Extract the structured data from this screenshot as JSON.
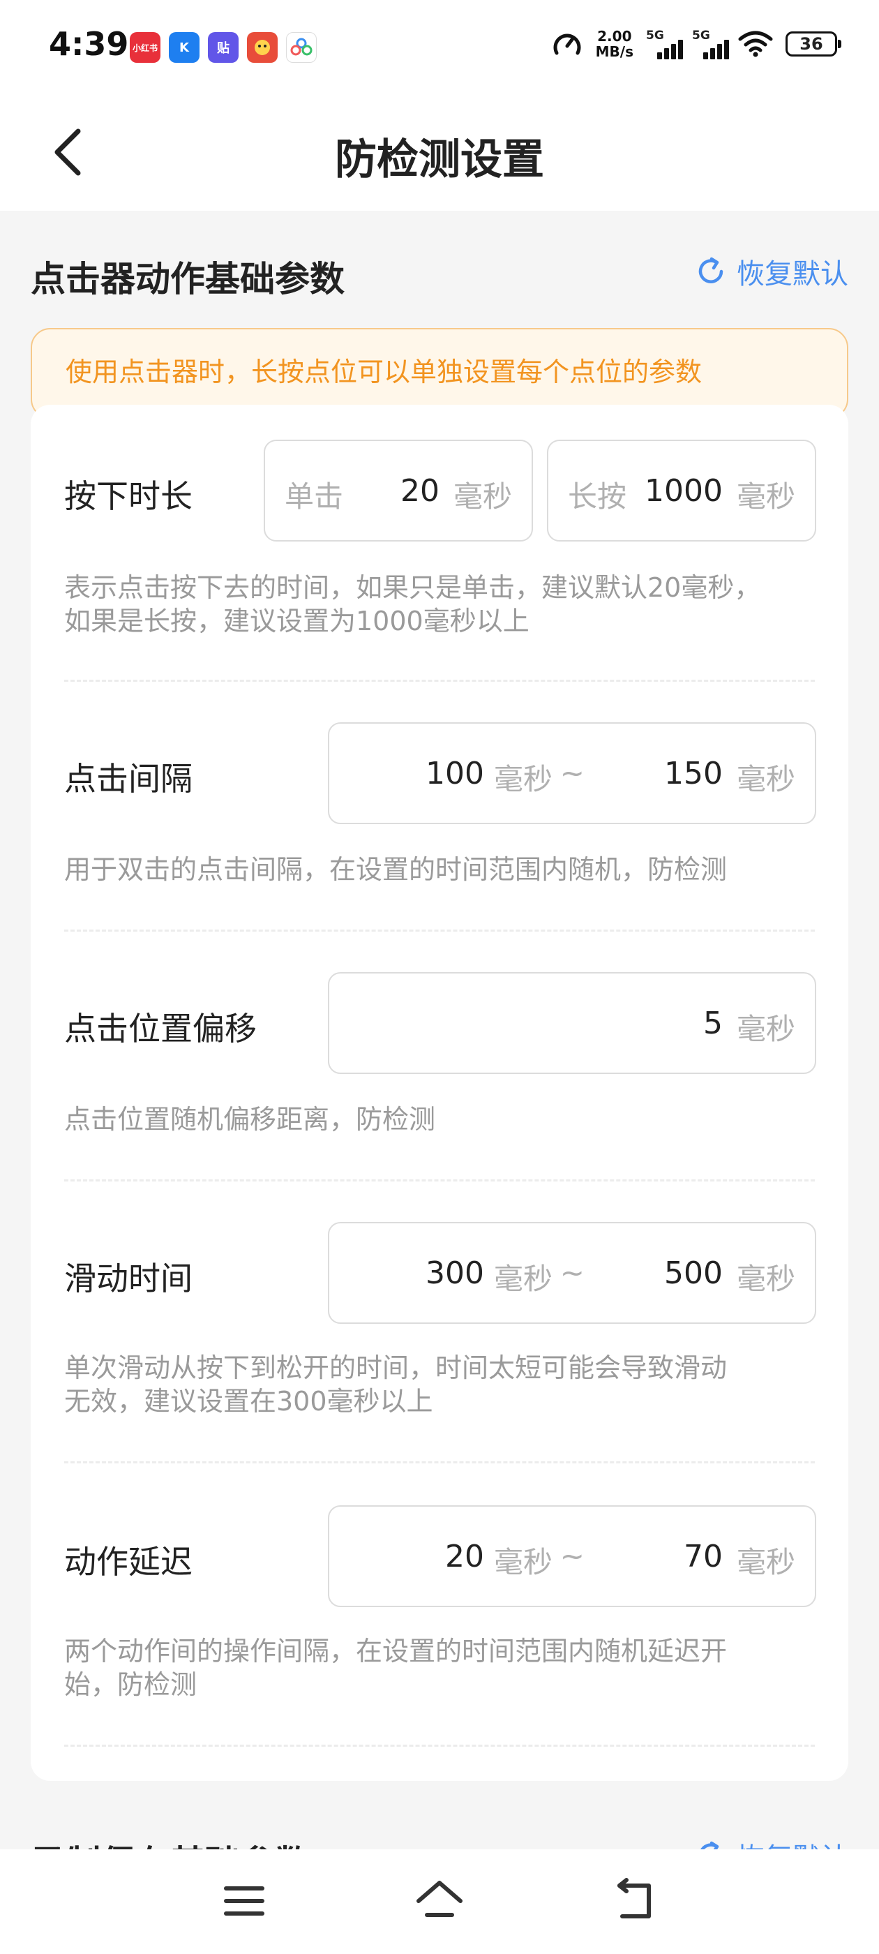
{
  "status_bar": {
    "time": "4:39",
    "apps": [
      {
        "name": "xiaohongshu-icon",
        "label": "小红书",
        "color": "#e8303a"
      },
      {
        "name": "k-app-icon",
        "label": "K",
        "color": "#1e7ff0"
      },
      {
        "name": "tie-app-icon",
        "label": "贴",
        "color": "#6156e8"
      },
      {
        "name": "game-app-icon",
        "label": "",
        "color": "#e84d3a"
      },
      {
        "name": "cloud-app-icon",
        "label": "",
        "color": "#ffffff"
      }
    ],
    "speed_value": "2.00",
    "speed_unit": "MB/s",
    "signal1": "5G",
    "signal2": "5G",
    "battery": "36"
  },
  "header": {
    "title": "防检测设置"
  },
  "section1": {
    "title": "点击器动作基础参数",
    "restore_label": "恢复默认",
    "notice": "使用点击器时，长按点位可以单独设置每个点位的参数"
  },
  "rows": {
    "press": {
      "label": "按下时长",
      "single_prefix": "单击",
      "single_value": "20",
      "long_prefix": "长按",
      "long_value": "1000",
      "unit": "毫秒",
      "desc_line1": "表示点击按下去的时间，如果只是单击，建议默认20毫秒，",
      "desc_line2": "如果是长按，建议设置为1000毫秒以上"
    },
    "interval": {
      "label": "点击间隔",
      "min": "100",
      "max": "150",
      "unit": "毫秒",
      "tilde": "~",
      "desc": "用于双击的点击间隔，在设置的时间范围内随机，防检测"
    },
    "offset": {
      "label": "点击位置偏移",
      "value": "5",
      "unit": "毫秒",
      "desc": "点击位置随机偏移距离，防检测"
    },
    "swipe": {
      "label": "滑动时间",
      "min": "300",
      "max": "500",
      "unit": "毫秒",
      "tilde": "~",
      "desc_line1": "单次滑动从按下到松开的时间，时间太短可能会导致滑动",
      "desc_line2": "无效，建议设置在300毫秒以上"
    },
    "delay": {
      "label": "动作延迟",
      "min": "20",
      "max": "70",
      "unit": "毫秒",
      "tilde": "~",
      "desc_line1": "两个动作间的操作间隔，在设置的时间范围内随机延迟开",
      "desc_line2": "始，防检测"
    }
  },
  "section2": {
    "title": "录制保存基础参数",
    "restore_label": "恢复默认"
  },
  "colors": {
    "accent": "#4a8fef",
    "notice_text": "#f29420",
    "notice_bg": "#fff7ea"
  }
}
